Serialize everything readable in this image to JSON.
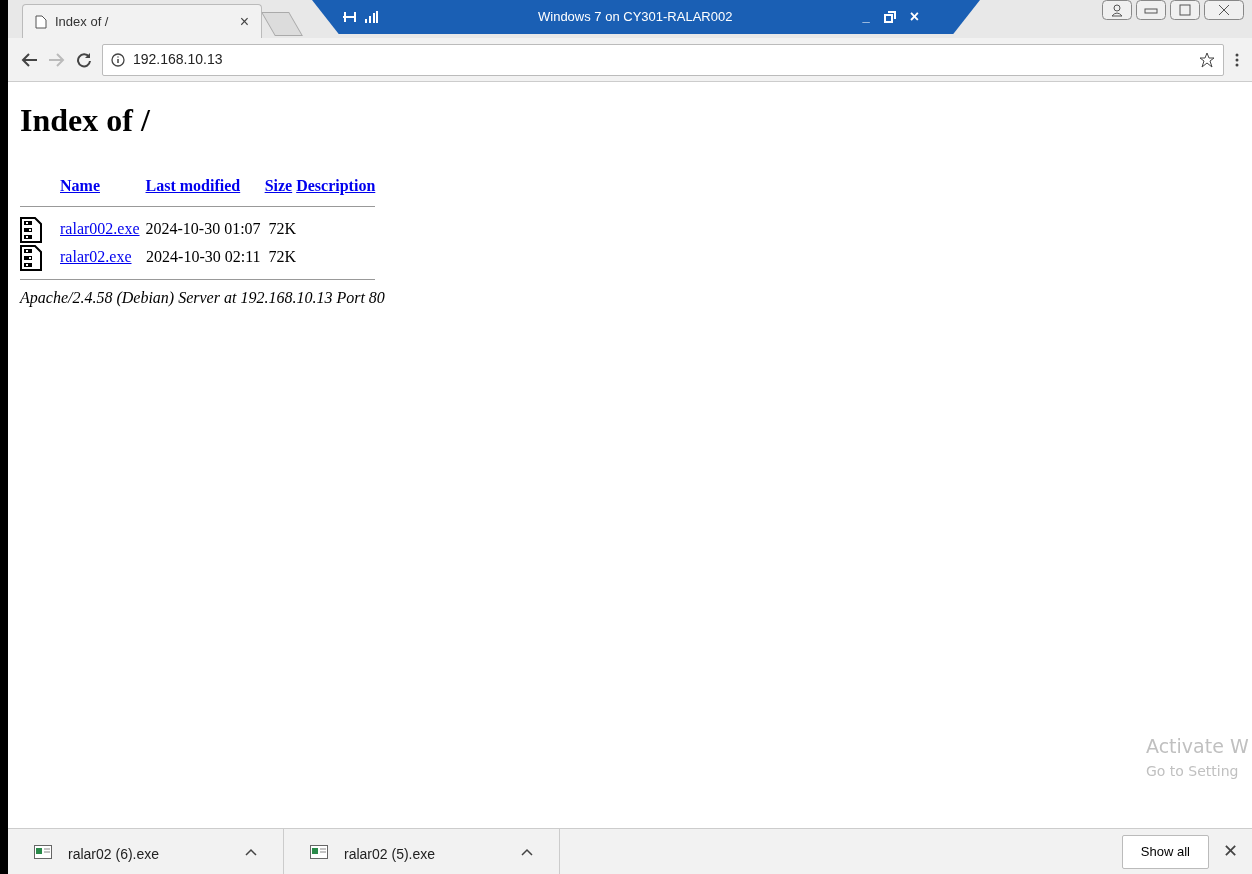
{
  "tab": {
    "title": "Index of /",
    "close": "×"
  },
  "remote_bar": {
    "title": "Windows 7 on CY301-RALAR002",
    "minimize": "_",
    "close": "×"
  },
  "address": {
    "url": "192.168.10.13"
  },
  "page": {
    "heading": "Index of /",
    "columns": [
      "Name",
      "Last modified",
      "Size",
      "Description"
    ],
    "rows": [
      {
        "name": "ralar002.exe",
        "modified": "2024-10-30 01:07",
        "size": "72K"
      },
      {
        "name": "ralar02.exe",
        "modified": "2024-10-30 02:11",
        "size": "72K"
      }
    ],
    "footer": "Apache/2.4.58 (Debian) Server at 192.168.10.13 Port 80"
  },
  "activation": {
    "title": "Activate W",
    "subtitle": "Go to Setting"
  },
  "downloads": {
    "items": [
      {
        "name": "ralar02 (6).exe"
      },
      {
        "name": "ralar02 (5).exe"
      }
    ],
    "show_all": "Show all",
    "close": "✕"
  }
}
